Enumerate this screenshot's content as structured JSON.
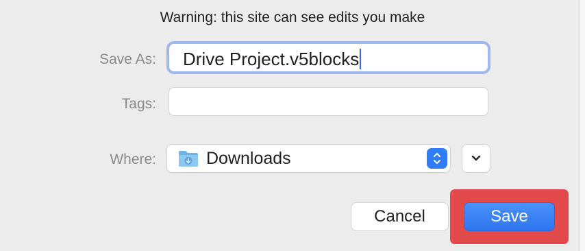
{
  "dialog": {
    "warning": "Warning: this site can see edits you make",
    "save_as": {
      "label": "Save As:",
      "value": "Drive Project.v5blocks"
    },
    "tags": {
      "label": "Tags:",
      "value": ""
    },
    "where": {
      "label": "Where:",
      "value": "Downloads",
      "icon": "downloads-folder-icon"
    },
    "buttons": {
      "cancel": "Cancel",
      "save": "Save"
    }
  },
  "colors": {
    "accent": "#2f7cf6",
    "focus_ring": "#9fb7ec",
    "highlight": "#e24a4c"
  }
}
